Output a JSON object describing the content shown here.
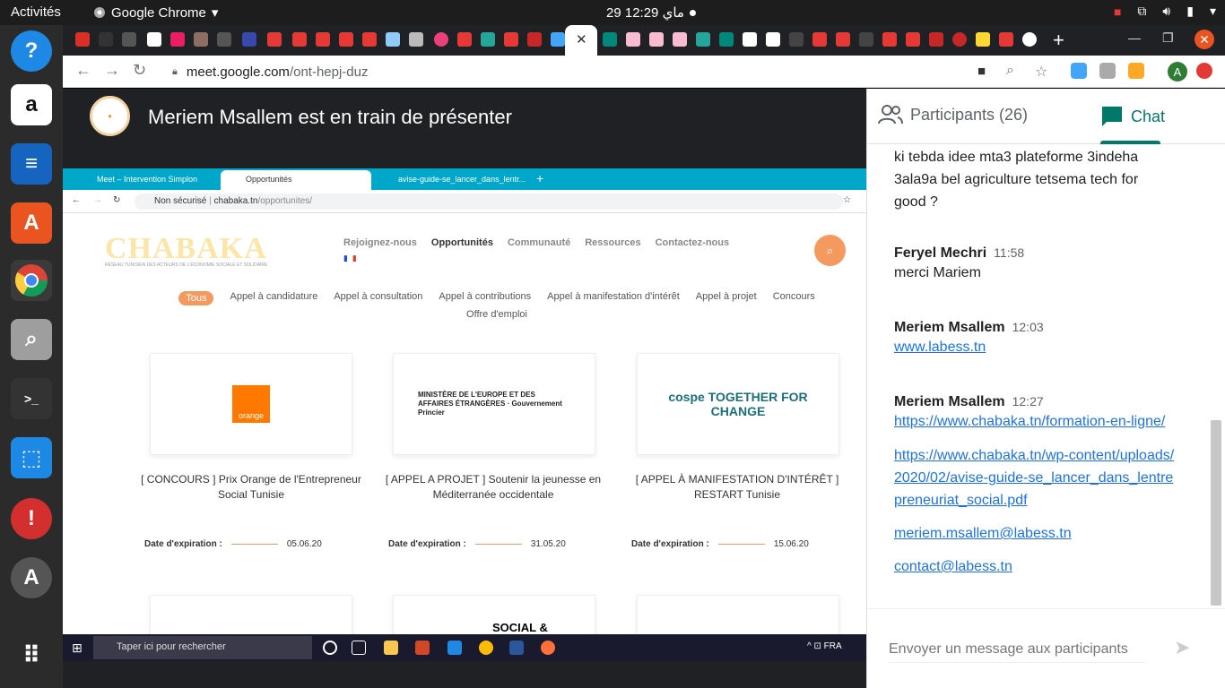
{
  "system": {
    "activities": "Activités",
    "app_name": "Google Chrome",
    "clock": "29 ماي 12:29"
  },
  "dock": {
    "items": [
      "help-icon",
      "amazon-icon",
      "writer-icon",
      "software-icon",
      "chrome-icon",
      "magnifier-icon",
      "terminal-icon",
      "screenshot-icon",
      "updates-icon",
      "appstore-icon",
      "app-grid-icon"
    ]
  },
  "browser": {
    "url_host": "meet.google.com",
    "url_path": "/ont-hepj-duz",
    "profile_initial": "A"
  },
  "presenter": {
    "title": "Meriem Msallem est en train de présenter"
  },
  "shared_screen": {
    "tabs": [
      "Meet – Intervention Simplon",
      "Opportunités",
      "avise-guide-se_lancer_dans_lentr..."
    ],
    "security": "Non sécurisé",
    "url_host": "chabaka.tn",
    "url_path": "/opportunites/",
    "site": {
      "logo": "CHABAKA",
      "logo_subtitle": "RÉSEAU TUNISIEN DES ACTEURS DE L'ÉCONOMIE SOCIALE ET SOLIDAIRE",
      "nav": [
        "Rejoignez-nous",
        "Opportunités",
        "Communauté",
        "Ressources",
        "Contactez-nous"
      ],
      "filters": [
        "Tous",
        "Appel à candidature",
        "Appel à consultation",
        "Appel à contributions",
        "Appel à manifestation d'intérêt",
        "Appel à projet",
        "Concours",
        "Offre d'emploi"
      ],
      "cards": [
        {
          "logo": "orange",
          "title": "[ CONCOURS ] Prix Orange de l'Entrepreneur Social Tunisie",
          "date": "05.06.20"
        },
        {
          "logo": "MINISTÈRE DE L'EUROPE ET DES AFFAIRES ÉTRANGÈRES · Gouvernement Princier",
          "title": "[ APPEL A PROJET ] Soutenir la jeunesse en Méditerranée occidentale",
          "date": "31.05.20"
        },
        {
          "logo": "cospe TOGETHER FOR CHANGE",
          "title": "[ APPEL À MANIFESTATION D'INTÉRÊT ] RESTART Tunisie",
          "date": "15.06.20"
        }
      ],
      "exp_label": "Date d'expiration :",
      "second_row_text": "SOCIAL &"
    },
    "taskbar": {
      "search": "Taper ici pour rechercher",
      "lang": "FRA"
    }
  },
  "side_panel": {
    "participants_label": "Participants (26)",
    "chat_label": "Chat",
    "messages": [
      {
        "lines": [
          "ki tebda idee  mta3 plateforme 3indeha",
          "3ala9a bel agriculture  tetsema tech for",
          "good ?"
        ]
      },
      {
        "sender": "Feryel Mechri",
        "time": "11:58",
        "lines": [
          "merci Mariem"
        ]
      },
      {
        "sender": "Meriem Msallem",
        "time": "12:03",
        "links": [
          "www.labess.tn"
        ]
      },
      {
        "sender": "Meriem Msallem",
        "time": "12:27",
        "links": [
          "https://www.chabaka.tn/formation-en-ligne/",
          "https://www.chabaka.tn/wp-content/uploads/2020/02/avise-guide-se_lancer_dans_lentrepreneuriat_social.pdf",
          "meriem.msallem@labess.tn",
          "contact@labess.tn"
        ]
      }
    ],
    "compose_placeholder": "Envoyer un message aux participants"
  },
  "colors": {
    "meet_accent": "#00796b",
    "link": "#1a73e8",
    "chabaka_orange": "#f59a5f"
  }
}
